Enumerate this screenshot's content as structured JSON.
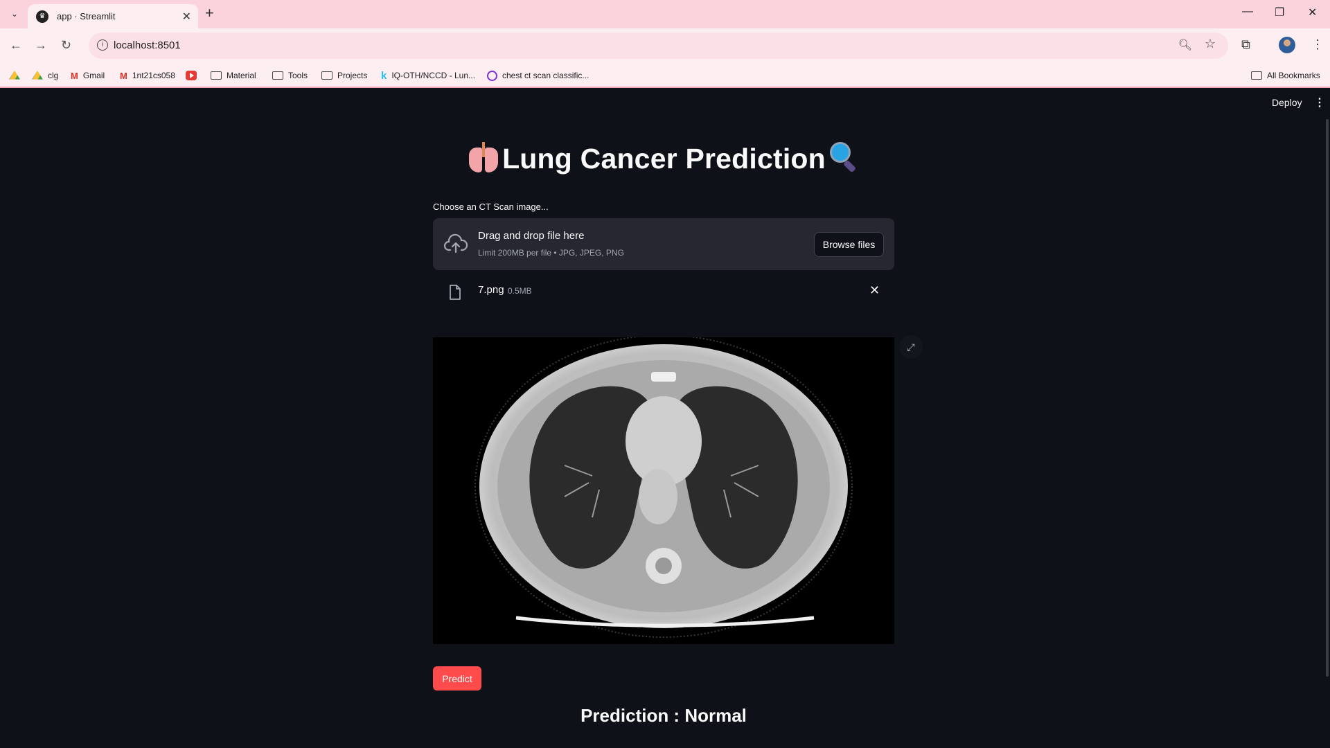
{
  "browser": {
    "tab_title": "app · Streamlit",
    "url": "localhost:8501",
    "bookmarks": [
      "clg",
      "Gmail",
      "1nt21cs058",
      "Material",
      "Tools",
      "Projects",
      "IQ-OTH/NCCD - Lun...",
      "chest ct scan classific..."
    ],
    "all_bookmarks": "All Bookmarks"
  },
  "app": {
    "deploy_label": "Deploy",
    "title": "Lung Cancer Prediction",
    "uploader": {
      "label": "Choose an CT Scan image...",
      "drag_text": "Drag and drop file here",
      "limit_text": "Limit 200MB per file • JPG, JPEG, PNG",
      "browse_label": "Browse files"
    },
    "file": {
      "name": "7.png",
      "size": "0.5MB"
    },
    "predict_label": "Predict",
    "prediction": "Prediction : Normal"
  },
  "colors": {
    "background": "#0e1117",
    "primary": "#ff4b4b",
    "surface": "#262730"
  },
  "icons": [
    "lungs-emoji",
    "magnifier-emoji",
    "cloud-upload-icon",
    "file-icon",
    "close-icon",
    "expand-icon"
  ]
}
